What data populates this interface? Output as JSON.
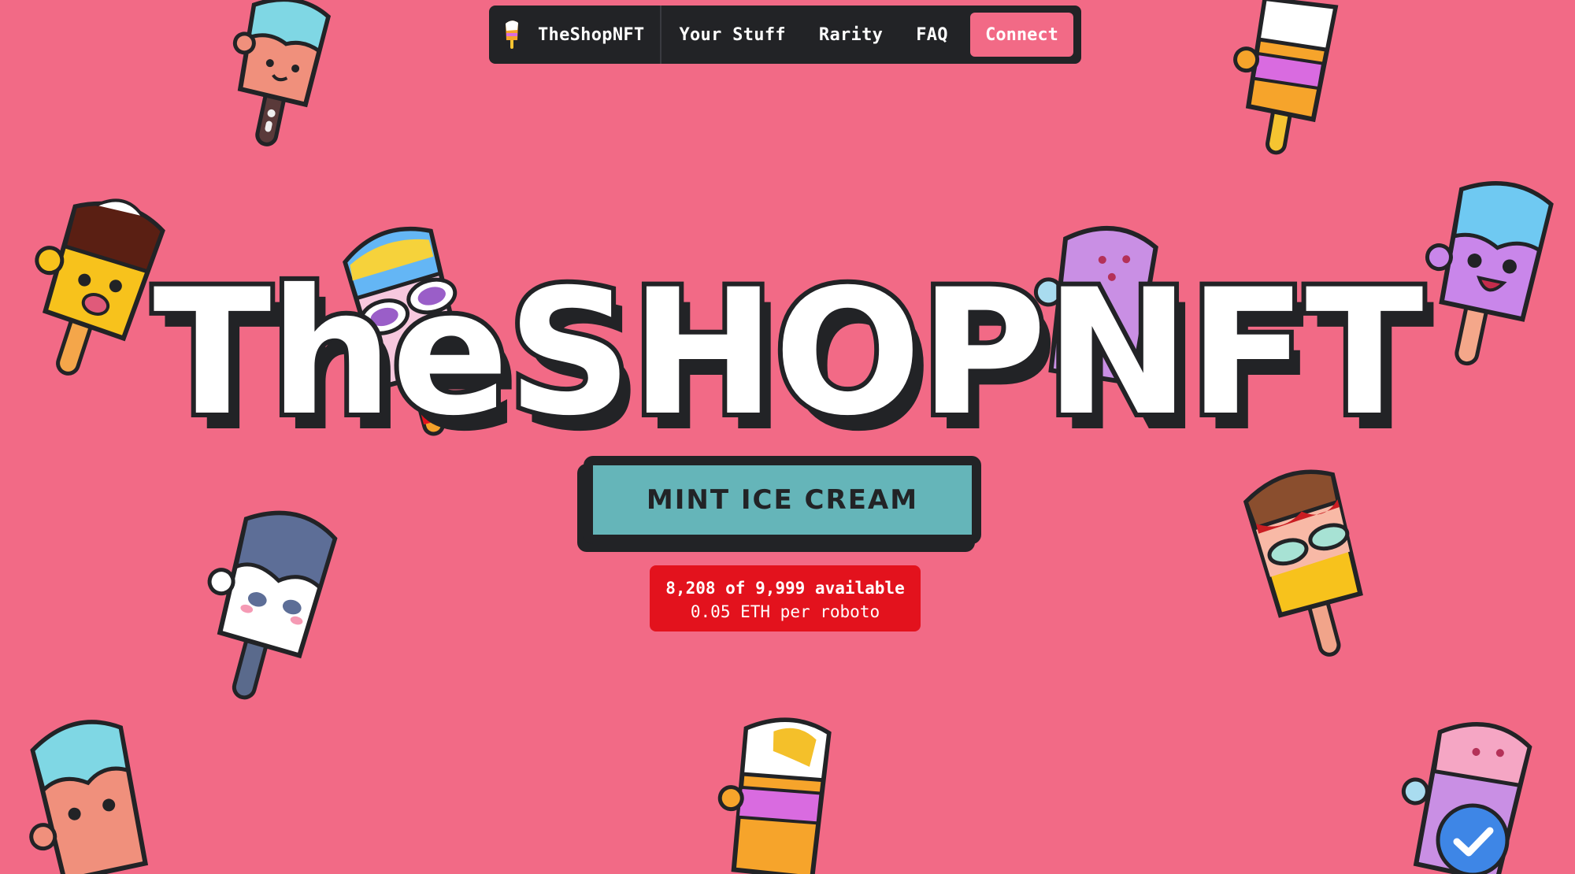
{
  "nav": {
    "brand": "TheShopNFT",
    "brand_icon": "popsicle-logo-icon",
    "links": [
      "Your Stuff",
      "Rarity",
      "FAQ"
    ],
    "connect_label": "Connect"
  },
  "hero": {
    "title": "TheSHOPNFT",
    "mint_label": "MINT ICE CREAM"
  },
  "availability": {
    "count_text": "8,208 of 9,999 available",
    "price_text": "0.05 ETH per roboto"
  },
  "colors": {
    "background": "#f26a86",
    "nav_bg": "#222326",
    "mint_button": "#65b5b9",
    "availability_badge": "#e3121d"
  }
}
